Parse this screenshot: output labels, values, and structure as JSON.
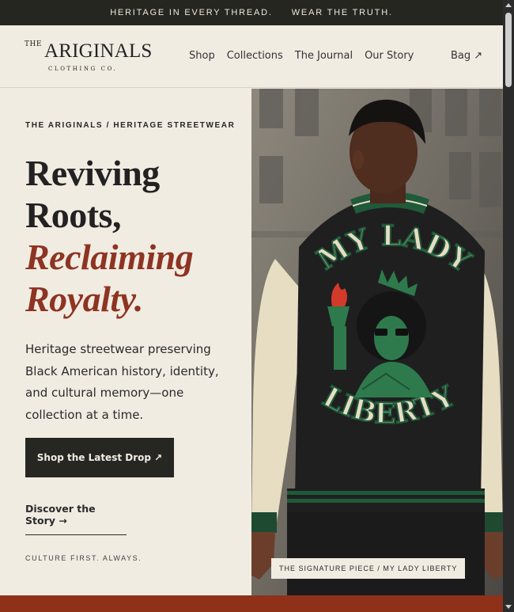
{
  "announcement": {
    "left": "HERITAGE IN EVERY THREAD.",
    "right": "WEAR THE TRUTH."
  },
  "brand": {
    "the": "THE",
    "name": "ARIGINALS",
    "sub": "CLOTHING CO."
  },
  "nav": {
    "items": [
      "Shop",
      "Collections",
      "The Journal",
      "Our Story"
    ],
    "bag": "Bag ↗"
  },
  "hero": {
    "eyebrow": "THE ARIGINALS / HERITAGE STREETWEAR",
    "headline_1": "Reviving",
    "headline_2": "Roots,",
    "headline_accent_1": "Reclaiming",
    "headline_accent_2": "Royalty.",
    "lede": "Heritage streetwear preserving Black American history, identity, and cultural memory—one collection at a time.",
    "cta": "Shop the Latest Drop ↗",
    "secondary": "Discover the Story →",
    "tagline": "CULTURE FIRST. ALWAYS.",
    "image_caption": "THE SIGNATURE PIECE / MY LADY LIBERTY",
    "jacket_text_top": "MY LADY",
    "jacket_text_bottom": "LIBERTY"
  },
  "colors": {
    "accent": "#8e3422",
    "dark": "#252620",
    "cream": "#f1ece2",
    "green": "#1f5a3a"
  }
}
